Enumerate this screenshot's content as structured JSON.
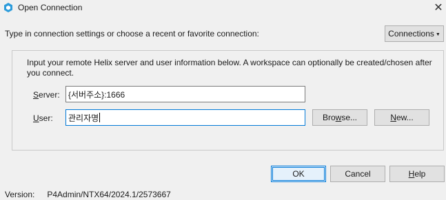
{
  "window": {
    "title": "Open Connection",
    "icon": "hexagon-app-icon",
    "close_glyph": "✕"
  },
  "instruction": "Type in connection settings or choose a recent or favorite connection:",
  "connections_menu": {
    "label": "Connections",
    "caret": "▼"
  },
  "group": {
    "info_text": "Input your remote Helix server and user information below. A workspace can optionally be created/chosen after you connect.",
    "server": {
      "label_mnemonic": "S",
      "label_rest": "erver:",
      "value": "{서버주소}:1666"
    },
    "user": {
      "label_mnemonic": "U",
      "label_rest": "ser:",
      "value": "관리자명"
    },
    "browse_button": {
      "label_start": "Bro",
      "label_mnemonic": "w",
      "label_end": "se..."
    },
    "new_button": {
      "label_mnemonic": "N",
      "label_rest": "ew..."
    }
  },
  "footer_buttons": {
    "ok": "OK",
    "cancel": "Cancel",
    "help_mnemonic": "H",
    "help_rest": "elp"
  },
  "version": {
    "label": "Version:",
    "value": "P4Admin/NTX64/2024.1/2573667"
  },
  "colors": {
    "accent": "#0078d7",
    "background": "#f0f0f0",
    "app_icon": "#2d9cdb"
  }
}
